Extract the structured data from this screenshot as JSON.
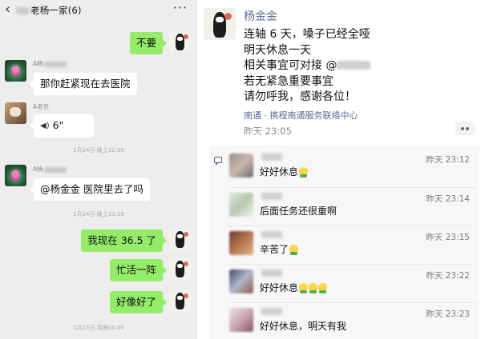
{
  "chat": {
    "header": {
      "title": "老杨一家(6)",
      "back_icon": "chevron-left-icon",
      "more_icon": "more-dots-icon"
    },
    "messages": [
      {
        "side": "right",
        "text": "不要"
      },
      {
        "side": "left",
        "sender": "A杨",
        "text": "那你赶紧现在去医院"
      },
      {
        "side": "left",
        "sender": "A老豆",
        "type": "voice",
        "text": "6\""
      },
      {
        "timestamp": "1月24日 晚上22:09"
      },
      {
        "side": "left",
        "sender": "A杨",
        "text": "@杨金金  医院里去了吗"
      },
      {
        "timestamp": "1月24日 晚上23:19"
      },
      {
        "side": "right",
        "text": "我现在 36.5 了"
      },
      {
        "side": "right",
        "text": "忙活一阵"
      },
      {
        "side": "right",
        "text": "好像好了"
      },
      {
        "timestamp": "1月25日 凌晨04:50"
      }
    ]
  },
  "moment": {
    "poster_name": "杨金金",
    "lines": [
      "连轴 6 天，嗓子已经全哑",
      "明天休息一天",
      "相关事宜可对接 @",
      "若无紧急重要事宜",
      "请勿呼我，感谢各位！"
    ],
    "link": "南通 · 携程南通服务联络中心",
    "time": "昨天 23:05",
    "comments": [
      {
        "text": "好好休息",
        "emoji_count": 1,
        "time": "昨天 23:12"
      },
      {
        "text": "后面任务还很重啊",
        "emoji_count": 0,
        "time": "昨天 23:14"
      },
      {
        "text": "辛苦了",
        "emoji_count": 1,
        "time": "昨天 23:15"
      },
      {
        "text": "好好休息",
        "emoji_count": 3,
        "time": "昨天 23:22"
      },
      {
        "text": "好好休息，明天有我",
        "emoji_count": 0,
        "time": "昨天 23:23"
      }
    ]
  },
  "colors": {
    "chat_bg": "#ededed",
    "green_bubble": "#95ec69",
    "link_blue": "#576b95"
  }
}
